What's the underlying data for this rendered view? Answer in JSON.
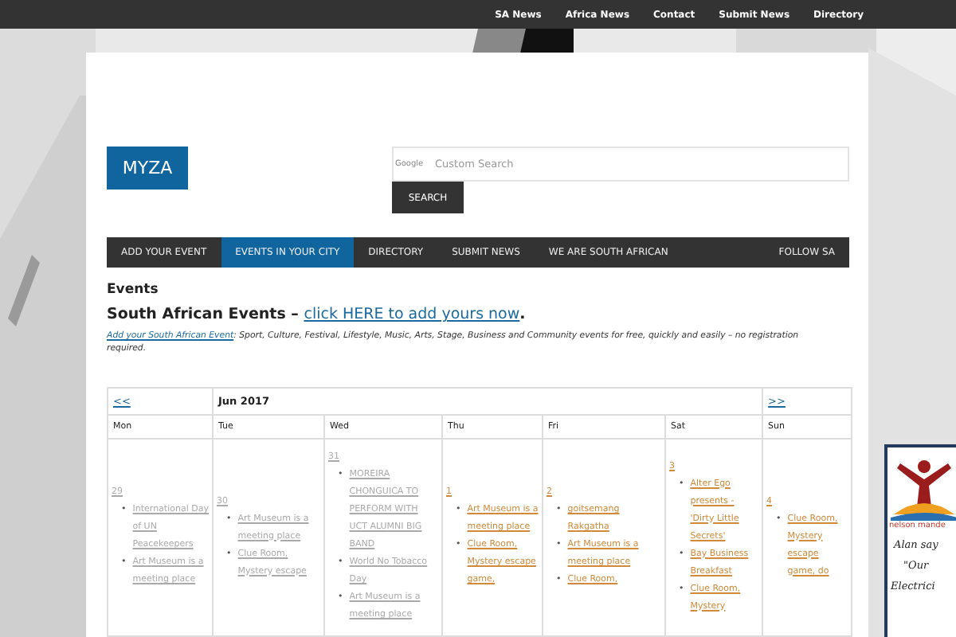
{
  "top_links": [
    "SA News",
    "Africa News",
    "Contact",
    "Submit News",
    "Directory"
  ],
  "logo": "MYZA",
  "search": {
    "brand": "Google",
    "placeholder": "Custom Search",
    "button": "SEARCH"
  },
  "nav": [
    {
      "label": "ADD YOUR EVENT",
      "selected": false
    },
    {
      "label": "EVENTS IN YOUR CITY",
      "selected": true
    },
    {
      "label": "DIRECTORY",
      "selected": false
    },
    {
      "label": "SUBMIT NEWS",
      "selected": false
    },
    {
      "label": "WE ARE SOUTH AFRICAN",
      "selected": false
    }
  ],
  "nav_right": "FOLLOW SA",
  "page_title": "Events",
  "subtitle": {
    "text": "South African Events – ",
    "link": "click HERE to add yours now",
    "after": "."
  },
  "intro": {
    "link": "Add your South African Event",
    "text": ": Sport, Culture, Festival, Lifestyle, Music, Arts, Stage, Business and Community events for free, quickly and easily – no registration required."
  },
  "calendar": {
    "prev": "<<",
    "month": "Jun 2017",
    "next": ">>",
    "bullet": "•",
    "weekdays": [
      "Mon",
      "Tue",
      "Wed",
      "Thu",
      "Fri",
      "Sat",
      "Sun"
    ],
    "days": [
      {
        "day": "29",
        "past": true,
        "events": [
          "International Day of UN Peacekeepers",
          "Art Museum is a meeting place"
        ]
      },
      {
        "day": "30",
        "past": true,
        "events": [
          "Art Museum is a meeting place",
          "Clue Room, Mystery escape"
        ]
      },
      {
        "day": "31",
        "past": true,
        "events": [
          "MOREIRA CHONGUICA TO PERFORM WITH UCT ALUMNI BIG BAND",
          "World No Tobacco Day",
          "Art Museum is a meeting place"
        ]
      },
      {
        "day": "1",
        "past": false,
        "events": [
          "Art Museum is a meeting place",
          "Clue Room, Mystery escape game,"
        ]
      },
      {
        "day": "2",
        "past": false,
        "events": [
          "goitsemang Rakgatha",
          "Art Museum is a meeting place",
          "Clue Room,"
        ]
      },
      {
        "day": "3",
        "past": false,
        "events": [
          "Alter Ego presents - 'Dirty Little Secrets'",
          "Bay Business Breakfast",
          "Clue Room, Mystery"
        ]
      },
      {
        "day": "4",
        "past": false,
        "events": [
          "Clue Room, Mystery escape game, do"
        ]
      }
    ]
  },
  "promo": {
    "brand": "nelson mande",
    "lines": [
      "Alan say",
      "\"Our",
      "Electrici"
    ]
  }
}
